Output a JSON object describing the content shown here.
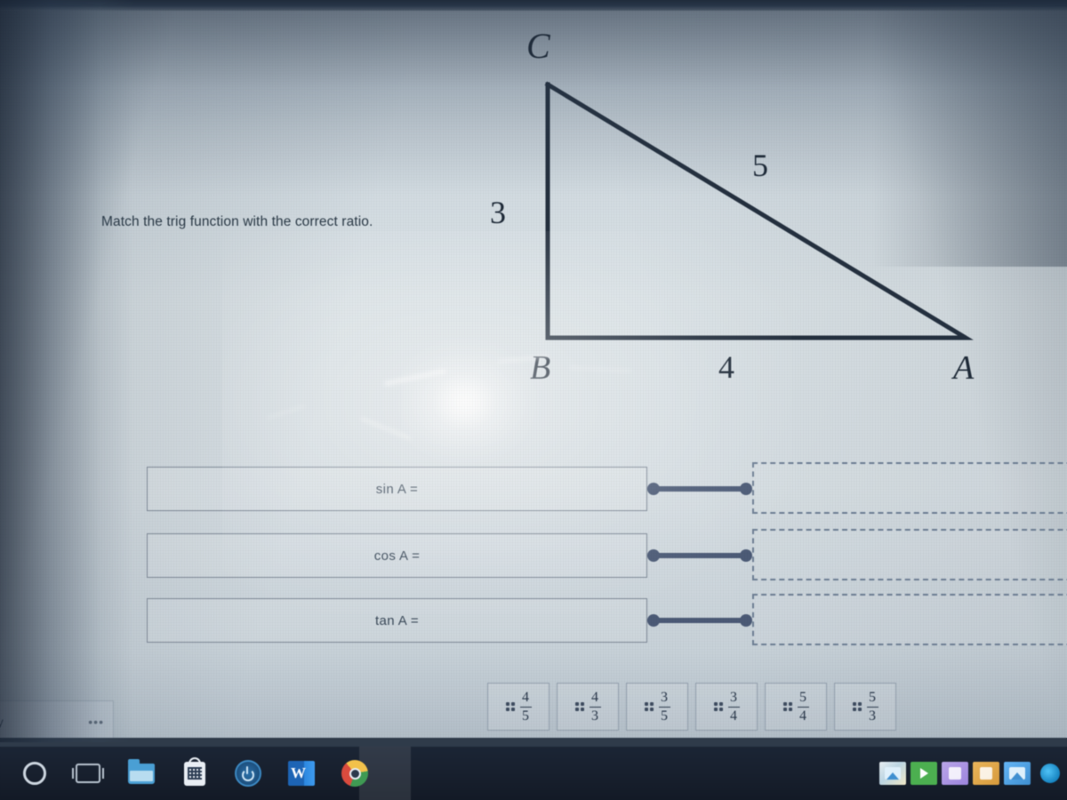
{
  "question": {
    "prompt": "Match the trig function with the correct ratio."
  },
  "figure": {
    "type": "right-triangle",
    "vertices": {
      "top": "C",
      "right_angle": "B",
      "right": "A"
    },
    "side_labels": {
      "vertical_leg": "3",
      "horizontal_leg": "4",
      "hypotenuse": "5"
    }
  },
  "match_rows": [
    {
      "label": "sin A =",
      "drop_placeholder": ""
    },
    {
      "label": "cos A =",
      "drop_placeholder": ""
    },
    {
      "label": "tan A =",
      "drop_placeholder": ""
    }
  ],
  "answer_tiles": [
    {
      "numerator": "4",
      "denominator": "5",
      "handle": "drag-handle-dots"
    },
    {
      "numerator": "4",
      "denominator": "3",
      "handle": "drag-handle-dots"
    },
    {
      "numerator": "3",
      "denominator": "5",
      "handle": "drag-handle-dots"
    },
    {
      "numerator": "3",
      "denominator": "4",
      "handle": "drag-handle-dots"
    },
    {
      "numerator": "5",
      "denominator": "4",
      "handle": "drag-handle-dots"
    },
    {
      "numerator": "5",
      "denominator": "3",
      "handle": "drag-handle-dots"
    }
  ],
  "corner_widget": {
    "text": "py",
    "dots": "•••"
  },
  "taskbar": {
    "items": [
      {
        "name": "cortana-icon",
        "label": ""
      },
      {
        "name": "task-view-icon",
        "label": ""
      },
      {
        "name": "file-explorer-icon",
        "label": ""
      },
      {
        "name": "microsoft-store-icon",
        "label": ""
      },
      {
        "name": "power-settings-icon",
        "label": ""
      },
      {
        "name": "word-icon",
        "label": "W"
      },
      {
        "name": "chrome-icon",
        "label": ""
      }
    ],
    "tray": [
      {
        "name": "photos-tray-icon"
      },
      {
        "name": "play-tray-icon"
      },
      {
        "name": "store-tray-icon"
      },
      {
        "name": "paint-tray-icon"
      },
      {
        "name": "image-tray-icon"
      },
      {
        "name": "edge-tray-icon"
      }
    ]
  },
  "colors": {
    "screen_bg": "#d7dfe4",
    "ink": "#2b3a47",
    "connector": "#4c5b77",
    "dashed_border": "#6d7e94",
    "taskbar_bg": "#18202e"
  }
}
